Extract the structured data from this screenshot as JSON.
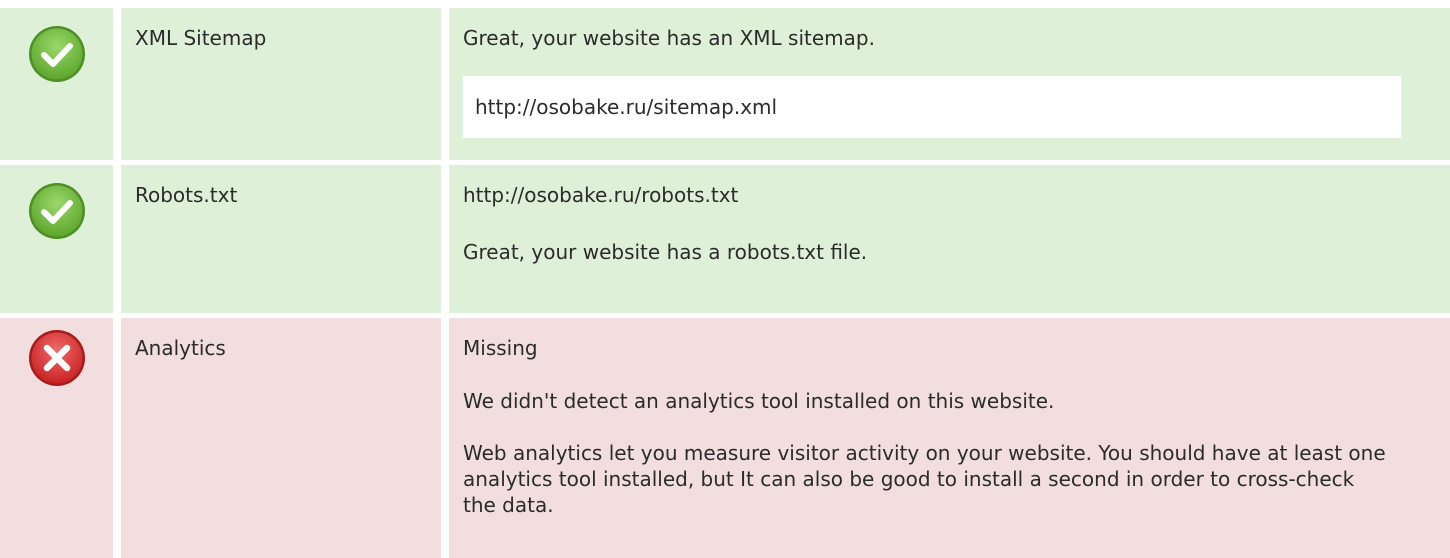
{
  "rows": [
    {
      "status": "pass",
      "icon": "check-icon",
      "label": "XML Sitemap",
      "message": "Great, your website has an XML sitemap.",
      "url": "http://osobake.ru/sitemap.xml"
    },
    {
      "status": "pass",
      "icon": "check-icon",
      "label": "Robots.txt",
      "url": "http://osobake.ru/robots.txt",
      "message": "Great, your website has a robots.txt file."
    },
    {
      "status": "fail",
      "icon": "error-x-icon",
      "label": "Analytics",
      "status_text": "Missing",
      "message": "We didn't detect an analytics tool installed on this website.",
      "advice": "Web analytics let you measure visitor activity on your website. You should have at least one analytics tool installed, but It can also be good to install a second in order to cross-check the data."
    }
  ],
  "colors": {
    "pass_background": "#dff0d8",
    "fail_background": "#f2dede",
    "pass_icon": "#7cc04a",
    "fail_icon": "#e03b3b"
  }
}
